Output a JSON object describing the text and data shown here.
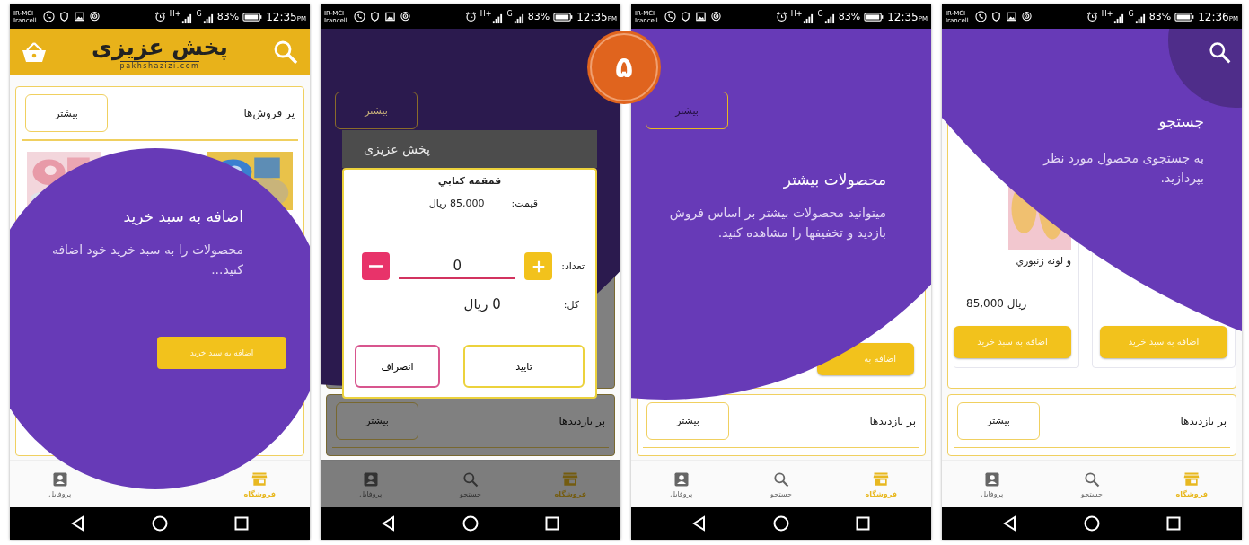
{
  "badge": {
    "label": "۵"
  },
  "phones": [
    {
      "kind": "search_tip",
      "status_bar": {
        "carrier": [
          "IR-MCI",
          "Irancell"
        ],
        "networks": [
          "G",
          "H+"
        ],
        "battery": "83%",
        "time": "12:36",
        "meridiem": "PM"
      },
      "tip": {
        "title": "جستجو",
        "text": "به جستجوی محصول مورد نظر بپردازید."
      },
      "products": [
        {
          "button": "اضافه به سبد خرید"
        },
        {
          "name": "و لونه زنبوري",
          "price": "85,000 ریال",
          "button": "اضافه به سبد خريد"
        }
      ],
      "section": {
        "title": "پر بازدیدها",
        "more": "بیشتر"
      },
      "nav": [
        {
          "kind": "shop",
          "label": "فروشگاه",
          "selected": true
        },
        {
          "kind": "search",
          "label": "جستجو",
          "selected": false
        },
        {
          "kind": "profile",
          "label": "پروفایل",
          "selected": false
        }
      ]
    },
    {
      "kind": "more_tip",
      "status_bar": {
        "carrier": [
          "IR-MCI",
          "Irancell"
        ],
        "networks": [
          "G",
          "H+"
        ],
        "battery": "83%",
        "time": "12:35",
        "meridiem": "PM"
      },
      "more": "بیشتر",
      "tip": {
        "title": "محصولات بیشتر",
        "text": "میتوانید محصولات بیشتر بر اساس فروش بازدید و تخفیفها را مشاهده کنید.",
        "button": "اضافه به"
      },
      "section": {
        "title": "پر بازدیدها",
        "more": "بیشتر"
      },
      "nav": [
        {
          "kind": "shop",
          "label": "فروشگاه",
          "selected": true
        },
        {
          "kind": "search",
          "label": "جستجو",
          "selected": false
        },
        {
          "kind": "profile",
          "label": "پروفایل",
          "selected": false
        }
      ]
    },
    {
      "kind": "quantity_dialog",
      "dimmed": true,
      "status_bar": {
        "carrier": [
          "IR-MCI",
          "Irancell"
        ],
        "networks": [
          "G",
          "H+"
        ],
        "battery": "83%",
        "time": "12:35",
        "meridiem": "PM"
      },
      "more": "بیشتر",
      "dialog": {
        "title": "پخش عزیزی",
        "product": "قمقمه کتابي",
        "price_label": "قیمت:",
        "price": "85,000 ریال",
        "qty_label": "تعداد:",
        "qty": "0",
        "total_label": "کل:",
        "total": "0 ریال",
        "confirm": "تایید",
        "cancel": "انصراف"
      },
      "section": {
        "title": "پر بازدیدها",
        "more": "بیشتر"
      },
      "nav": [
        {
          "kind": "shop",
          "label": "فروشگاه",
          "selected": true
        },
        {
          "kind": "search",
          "label": "جستجو",
          "selected": false
        },
        {
          "kind": "profile",
          "label": "پروفایل",
          "selected": false
        }
      ]
    },
    {
      "kind": "add_to_cart_tip",
      "status_bar": {
        "carrier": [
          "IR-MCI",
          "Irancell"
        ],
        "networks": [
          "G",
          "H+"
        ],
        "battery": "83%",
        "time": "12:35",
        "meridiem": "PM"
      },
      "header": {
        "logo": "پخش عزیزی",
        "domain": "pakhshazizi.com"
      },
      "section": {
        "title": "پر فروش‌ها",
        "more": "بیشتر"
      },
      "tip": {
        "title": "اضافه به سبد خرید",
        "text": "محصولات را به سبد خرید خود اضافه کنید...",
        "button": "اضافه به سبد خرید"
      },
      "nav": [
        {
          "kind": "shop",
          "label": "فروشگاه",
          "selected": true
        },
        {
          "kind": "profile",
          "label": "پروفایل",
          "selected": false
        }
      ]
    }
  ]
}
